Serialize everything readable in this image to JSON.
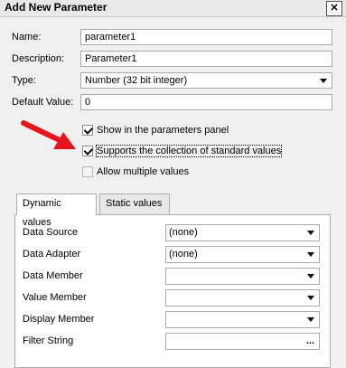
{
  "window": {
    "title": "Add New Parameter",
    "close_glyph": "✕"
  },
  "form": {
    "name": {
      "label": "Name:",
      "value": "parameter1"
    },
    "description": {
      "label": "Description:",
      "value": "Parameter1"
    },
    "type": {
      "label": "Type:",
      "value": "Number (32 bit integer)"
    },
    "default_value": {
      "label": "Default Value:",
      "value": "0"
    }
  },
  "options": {
    "show_in_panel": {
      "label": "Show in the parameters panel",
      "checked": true
    },
    "supports_standard_values": {
      "label": "Supports the collection of standard values",
      "checked": true
    },
    "allow_multiple": {
      "label": "Allow multiple values",
      "checked": false
    }
  },
  "annotation": {
    "arrow_color": "#e8141b"
  },
  "tabs": [
    {
      "label": "Dynamic values",
      "active": true
    },
    {
      "label": "Static values",
      "active": false
    }
  ],
  "dynamic": {
    "data_source": {
      "label": "Data Source",
      "value": "(none)"
    },
    "data_adapter": {
      "label": "Data Adapter",
      "value": "(none)"
    },
    "data_member": {
      "label": "Data Member",
      "value": ""
    },
    "value_member": {
      "label": "Value Member",
      "value": ""
    },
    "display_member": {
      "label": "Display Member",
      "value": ""
    },
    "filter_string": {
      "label": "Filter String",
      "value": "",
      "button": "..."
    }
  }
}
